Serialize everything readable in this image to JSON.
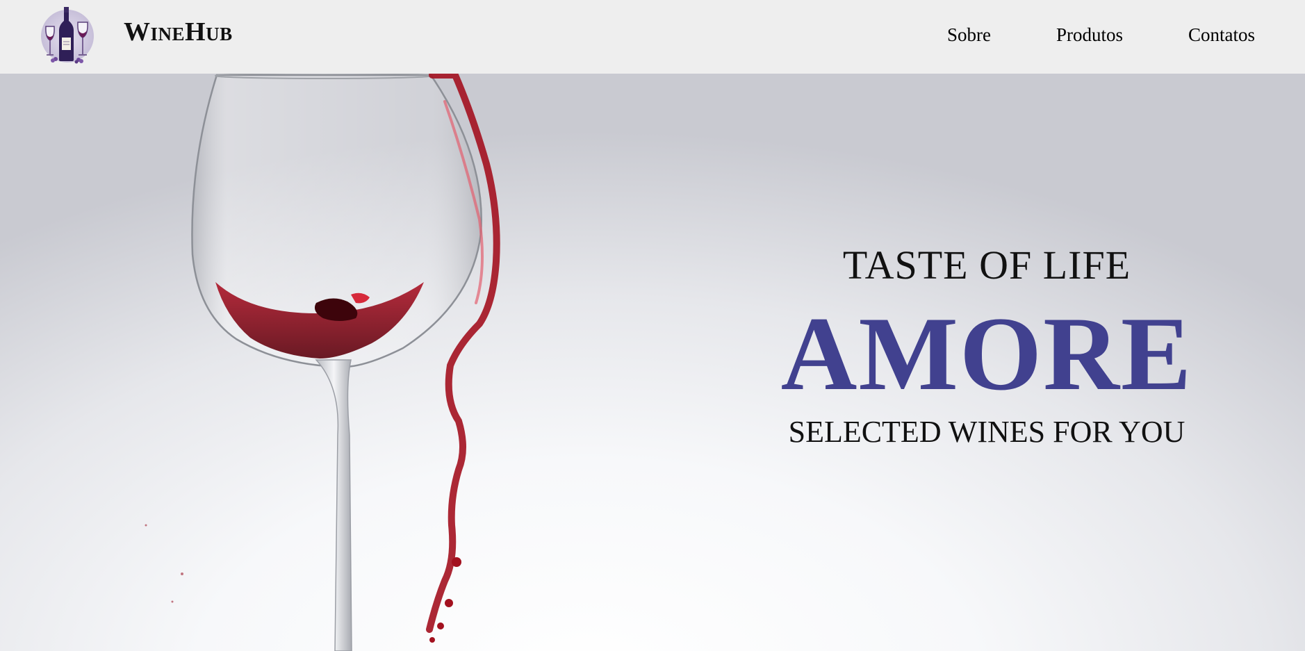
{
  "header": {
    "brand": "WineHub",
    "logo_icon": "wine-bottle-glasses-icon",
    "nav": [
      {
        "label": "Sobre"
      },
      {
        "label": "Produtos"
      },
      {
        "label": "Contatos"
      }
    ]
  },
  "hero": {
    "tagline_top": "TASTE OF LIFE",
    "headline": "AMORE",
    "tagline_bottom": "SELECTED WINES FOR YOU",
    "image": "wine-glass-pour-image"
  },
  "colors": {
    "navbar_bg": "#eeeeee",
    "headline": "#41418f",
    "wine": "#9b1022"
  }
}
